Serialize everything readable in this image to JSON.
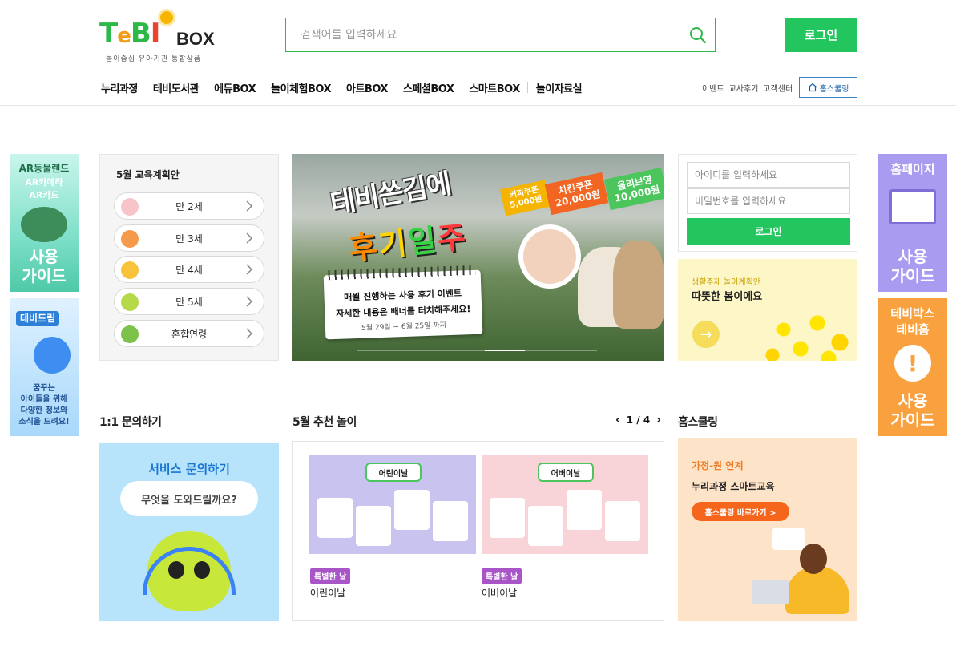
{
  "header": {
    "logo": {
      "brand": "TeBi",
      "suffix": "BOX",
      "tagline": "놀이중심 유아기관 통합상품"
    },
    "search": {
      "placeholder": "검색어를 입력하세요"
    },
    "login_label": "로그인",
    "nav": [
      "누리과정",
      "테비도서관",
      "에듀BOX",
      "놀이체험BOX",
      "아트BOX",
      "스페셜BOX",
      "스마트BOX",
      "놀이자료실"
    ],
    "util": [
      "이벤트",
      "교사후기",
      "고객센터"
    ],
    "homeschool_label": "홈스쿨링"
  },
  "side_banners": {
    "left_top": {
      "lines": [
        "AR동물랜드",
        "AR카메라",
        "AR카드",
        "사용",
        "가이드"
      ]
    },
    "left_bottom": {
      "title": "테비드림",
      "lines": [
        "꿈꾸는",
        "아이들을 위해",
        "다양한 정보와",
        "소식을 드려요!"
      ]
    },
    "right_top": {
      "lines": [
        "홈페이지",
        "사용",
        "가이드"
      ]
    },
    "right_bottom": {
      "lines": [
        "테비박스",
        "테비홈",
        "사용",
        "가이드"
      ]
    }
  },
  "plan": {
    "title": "5월 교육계획안",
    "ages": [
      {
        "label": "만 2세",
        "color": "#f7c5c9"
      },
      {
        "label": "만 3세",
        "color": "#f59a4a"
      },
      {
        "label": "만 4세",
        "color": "#f8c23a"
      },
      {
        "label": "만 5세",
        "color": "#b6d94a"
      },
      {
        "label": "혼합연령",
        "color": "#7cc24a"
      }
    ]
  },
  "hero": {
    "title_line1": "테비쓴김에",
    "title_line2": [
      "후",
      "기",
      "일",
      "주"
    ],
    "coupons": [
      {
        "name": "커피쿠폰",
        "amount": "5,000원",
        "color": "#f5b400"
      },
      {
        "name": "치킨쿠폰",
        "amount": "20,000원",
        "color": "#f26522"
      },
      {
        "name": "올리브영",
        "amount": "10,000원",
        "color": "#4cc55c"
      }
    ],
    "note_line1": "매월 진행하는 사용 후기 이벤트",
    "note_line2": "자세한 내용은 배너를 터치해주세요!",
    "note_period": "5월 29일 ~ 6월 25일 까지"
  },
  "login": {
    "id_placeholder": "아이디를 입력하세요",
    "pw_placeholder": "비밀번호를 입력하세요",
    "button": "로그인"
  },
  "spring": {
    "subtitle": "생활주제 놀이계획안",
    "title": "따뜻한 봄이에요"
  },
  "inquiry": {
    "section_title": "1:1 문의하기",
    "banner_title": "서비스 문의하기",
    "bubble": "무엇을 도와드릴까요?"
  },
  "recommend": {
    "section_title": "5월 추천 놀이",
    "pager": "1 / 4",
    "cards": [
      {
        "tag": "어린이날",
        "badge": "특별한 날",
        "name": "어린이날",
        "bg": "#c9c3f0"
      },
      {
        "tag": "어버이날",
        "badge": "특별한 날",
        "name": "어버이날",
        "bg": "#f8d3d8"
      }
    ]
  },
  "homeschooling": {
    "section_title": "홈스쿨링",
    "line1": "가정-원 연계",
    "line2": "누리과정 스마트교육",
    "button": "홈스쿨링 바로가기 >"
  }
}
